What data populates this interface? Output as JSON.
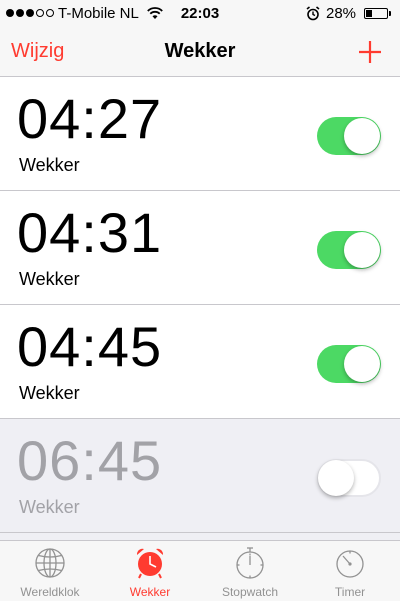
{
  "status_bar": {
    "carrier": "T-Mobile NL",
    "time": "22:03",
    "battery": "28%",
    "battery_level": 0.28,
    "signal_bars_filled": 3,
    "signal_bars_total": 5
  },
  "navbar": {
    "edit_label": "Wijzig",
    "title": "Wekker",
    "add_icon": "plus-icon"
  },
  "alarms": [
    {
      "time": "04:27",
      "label": "Wekker",
      "enabled": true
    },
    {
      "time": "04:31",
      "label": "Wekker",
      "enabled": true
    },
    {
      "time": "04:45",
      "label": "Wekker",
      "enabled": true
    },
    {
      "time": "06:45",
      "label": "Wekker",
      "enabled": false
    }
  ],
  "tabs": [
    {
      "label": "Wereldklok",
      "icon": "globe-icon",
      "active": false
    },
    {
      "label": "Wekker",
      "icon": "alarm-clock-icon",
      "active": true
    },
    {
      "label": "Stopwatch",
      "icon": "stopwatch-icon",
      "active": false
    },
    {
      "label": "Timer",
      "icon": "timer-icon",
      "active": false
    }
  ],
  "colors": {
    "accent": "#ff3b30",
    "toggle_on": "#4cd964",
    "inactive_text": "#a2a2a7",
    "tab_inactive": "#929292"
  }
}
